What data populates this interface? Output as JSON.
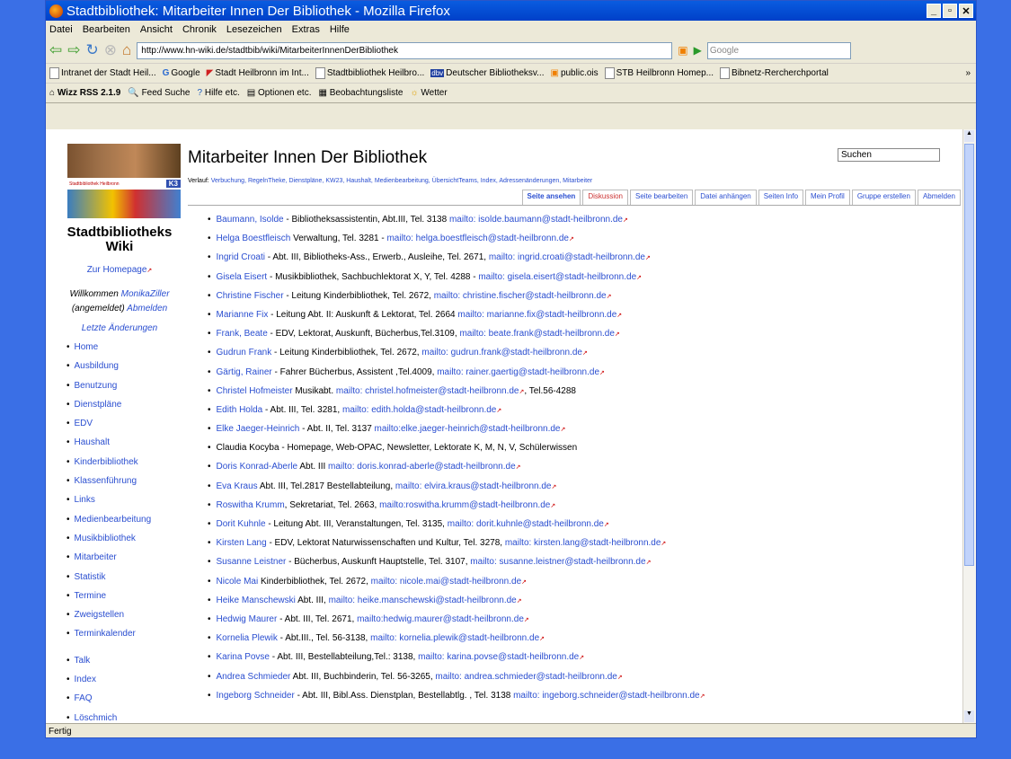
{
  "window": {
    "title": "Stadtbibliothek: Mitarbeiter Innen Der Bibliothek - Mozilla Firefox"
  },
  "menu": [
    "Datei",
    "Bearbeiten",
    "Ansicht",
    "Chronik",
    "Lesezeichen",
    "Extras",
    "Hilfe"
  ],
  "url": "http://www.hn-wiki.de/stadtbib/wiki/MitarbeiterInnenDerBibliothek",
  "search_engine": "Google",
  "bookmarks": [
    "Intranet der Stadt Heil...",
    "Google",
    "Stadt Heilbronn im Int...",
    "Stadtbibliothek Heilbro...",
    "Deutscher Bibliotheksv...",
    "public.ois",
    "STB Heilbronn Homep...",
    "Bibnetz-Rercherchportal"
  ],
  "toolbar3": [
    "Wizz RSS 2.1.9",
    "Feed Suche",
    "Hilfe etc.",
    "Optionen etc.",
    "Beobachtungsliste",
    "Wetter"
  ],
  "status": "Fertig",
  "logo": {
    "caption": "Stadtbibliothek Heilbronn",
    "badge": "K3"
  },
  "sidebar": {
    "title": "Stadtbibliotheks Wiki",
    "home_link": "Zur Homepage",
    "welcome": "Willkommen",
    "user": "MonikaZiller",
    "logged": "(angemeldet)",
    "logout": "Abmelden",
    "recent": "Letzte Änderungen",
    "items": [
      "Home",
      "Ausbildung",
      "Benutzung",
      "Dienstpläne",
      "EDV",
      "Haushalt",
      "Kinderbibliothek",
      "Klassenführung",
      "Links",
      "Medienbearbeitung",
      "Musikbibliothek",
      "Mitarbeiter",
      "Statistik",
      "Termine",
      "Zweigstellen",
      "Terminkalender"
    ],
    "items2": [
      "Talk",
      "Index",
      "FAQ",
      "Löschmich"
    ]
  },
  "page": {
    "title": "Mitarbeiter Innen Der Bibliothek",
    "search": "Suchen",
    "verlauf_label": "Verlauf:",
    "verlauf": "Verbuchung, RegelnTheke, Dienstpläne, KW23, Haushalt, Medienbearbeitung, ÜbersichtTeams, Index, Adressenänderungen, Mitarbeiter",
    "tabs": [
      "Seite ansehen",
      "Diskussion",
      "Seite bearbeiten",
      "Datei anhängen",
      "Seiten Info",
      "Mein Profil",
      "Gruppe erstellen",
      "Abmelden"
    ]
  },
  "staff": [
    {
      "name": "Baumann, Isolde",
      "info": " - Bibliotheksassistentin, Abt.III, Tel. 3138 ",
      "mail": "mailto: isolde.baumann@stadt-heilbronn.de",
      "after": ""
    },
    {
      "name": "Helga Boestfleisch",
      "info": " Verwaltung, Tel. 3281 - ",
      "mail": "mailto: helga.boestfleisch@stadt-heilbronn.de",
      "after": ""
    },
    {
      "name": "Ingrid Croati",
      "info": " - Abt. III, Bibliotheks-Ass., Erwerb., Ausleihe, Tel. 2671, ",
      "mail": "mailto: ingrid.croati@stadt-heilbronn.de",
      "after": ""
    },
    {
      "name": "Gisela Eisert",
      "info": " - Musikbibliothek, Sachbuchlektorat X, Y, Tel. 4288 - ",
      "mail": "mailto: gisela.eisert@stadt-heilbronn.de",
      "after": ""
    },
    {
      "name": "Christine Fischer",
      "info": " - Leitung Kinderbibliothek, Tel. 2672, ",
      "mail": "mailto: christine.fischer@stadt-heilbronn.de",
      "after": ""
    },
    {
      "name": "Marianne Fix",
      "info": " - Leitung Abt. II: Auskunft & Lektorat, Tel. 2664 ",
      "mail": "mailto: marianne.fix@stadt-heilbronn.de",
      "after": ""
    },
    {
      "name": "Frank, Beate",
      "info": " - EDV, Lektorat, Auskunft, Bücherbus,Tel.3109, ",
      "mail": "mailto: beate.frank@stadt-heilbronn.de",
      "after": ""
    },
    {
      "name": "Gudrun Frank",
      "info": " - Leitung Kinderbibliothek, Tel. 2672, ",
      "mail": "mailto: gudrun.frank@stadt-heilbronn.de",
      "after": ""
    },
    {
      "name": "Gärtig, Rainer",
      "info": " - Fahrer Bücherbus, Assistent ,Tel.4009, ",
      "mail": "mailto: rainer.gaertig@stadt-heilbronn.de",
      "after": ""
    },
    {
      "name": "Christel Hofmeister",
      "info": " Musikabt. ",
      "mail": "mailto: christel.hofmeister@stadt-heilbronn.de",
      "after": ", Tel.56-4288"
    },
    {
      "name": "Edith Holda",
      "info": " - Abt. III, Tel. 3281, ",
      "mail": "mailto: edith.holda@stadt-heilbronn.de",
      "after": ""
    },
    {
      "name": "Elke Jaeger-Heinrich",
      "info": " - Abt. II, Tel. 3137 ",
      "mail": "mailto:elke.jaeger-heinrich@stadt-heilbronn.de",
      "after": ""
    },
    {
      "name": "",
      "info": "Claudia Kocyba - Homepage, Web-OPAC, Newsletter, Lektorate K, M, N, V, Schülerwissen",
      "mail": "",
      "after": ""
    },
    {
      "name": "Doris Konrad-Aberle",
      "info": " Abt. III ",
      "mail": "mailto: doris.konrad-aberle@stadt-heilbronn.de",
      "after": ""
    },
    {
      "name": "Eva Kraus",
      "info": " Abt. III, Tel.2817 Bestellabteilung, ",
      "mail": "mailto: elvira.kraus@stadt-heilbronn.de",
      "after": ""
    },
    {
      "name": "Roswitha Krumm",
      "info": ", Sekretariat, Tel. 2663, ",
      "mail": "mailto:roswitha.krumm@stadt-heilbronn.de",
      "after": ""
    },
    {
      "name": "Dorit Kuhnle",
      "info": " - Leitung Abt. III, Veranstaltungen, Tel. 3135, ",
      "mail": "mailto: dorit.kuhnle@stadt-heilbronn.de",
      "after": ""
    },
    {
      "name": "Kirsten Lang",
      "info": " - EDV, Lektorat Naturwissenschaften und Kultur, Tel. 3278, ",
      "mail": "mailto: kirsten.lang@stadt-heilbronn.de",
      "after": ""
    },
    {
      "name": "Susanne Leistner",
      "info": " - Bücherbus, Auskunft Hauptstelle, Tel. 3107, ",
      "mail": "mailto: susanne.leistner@stadt-heilbronn.de",
      "after": ""
    },
    {
      "name": "Nicole Mai",
      "info": " Kinderbibliothek, Tel. 2672, ",
      "mail": "mailto: nicole.mai@stadt-heilbronn.de",
      "after": ""
    },
    {
      "name": "Heike Manschewski",
      "info": " Abt. III, ",
      "mail": "mailto: heike.manschewski@stadt-heilbronn.de",
      "after": ""
    },
    {
      "name": "Hedwig Maurer",
      "info": " - Abt. III, Tel. 2671, ",
      "mail": "mailto:hedwig.maurer@stadt-heilbronn.de",
      "after": ""
    },
    {
      "name": "Kornelia Plewik",
      "info": " - Abt.III., Tel. 56-3138, ",
      "mail": "mailto: kornelia.plewik@stadt-heilbronn.de",
      "after": ""
    },
    {
      "name": "Karina Povse",
      "info": " - Abt. III, Bestellabteilung,Tel.: 3138, ",
      "mail": "mailto: karina.povse@stadt-heilbronn.de",
      "after": ""
    },
    {
      "name": "Andrea Schmieder",
      "info": " Abt. III, Buchbinderin, Tel. 56-3265, ",
      "mail": "mailto: andrea.schmieder@stadt-heilbronn.de",
      "after": ""
    },
    {
      "name": "Ingeborg Schneider",
      "info": " - Abt. III, Bibl.Ass. Dienstplan, Bestellabtlg. , Tel. 3138 ",
      "mail": "mailto: ingeborg.schneider@stadt-heilbronn.de",
      "after": ""
    }
  ]
}
